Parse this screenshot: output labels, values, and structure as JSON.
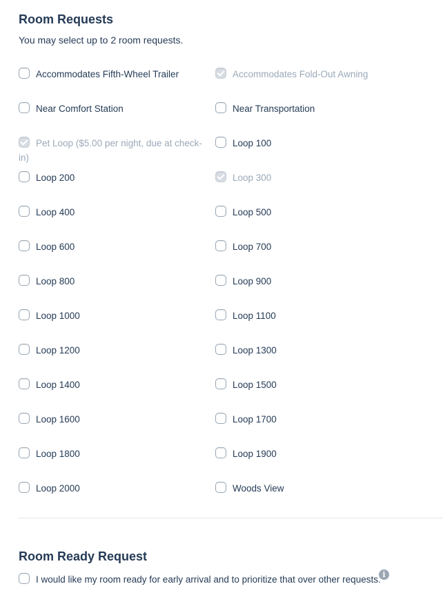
{
  "room_requests": {
    "title": "Room Requests",
    "subtitle": "You may select up to 2 room requests.",
    "options": [
      {
        "label": "Accommodates Fifth-Wheel Trailer",
        "checked": false,
        "disabled": false
      },
      {
        "label": "Accommodates Fold-Out Awning",
        "checked": true,
        "disabled": true
      },
      {
        "label": "Near Comfort Station",
        "checked": false,
        "disabled": false
      },
      {
        "label": "Near Transportation",
        "checked": false,
        "disabled": false
      },
      {
        "label": "Pet Loop ($5.00 per night, due at check-in)",
        "checked": true,
        "disabled": true
      },
      {
        "label": "Loop 100",
        "checked": false,
        "disabled": false
      },
      {
        "label": "Loop 200",
        "checked": false,
        "disabled": false
      },
      {
        "label": "Loop 300",
        "checked": true,
        "disabled": true
      },
      {
        "label": "Loop 400",
        "checked": false,
        "disabled": false
      },
      {
        "label": "Loop 500",
        "checked": false,
        "disabled": false
      },
      {
        "label": "Loop 600",
        "checked": false,
        "disabled": false
      },
      {
        "label": "Loop 700",
        "checked": false,
        "disabled": false
      },
      {
        "label": "Loop 800",
        "checked": false,
        "disabled": false
      },
      {
        "label": "Loop 900",
        "checked": false,
        "disabled": false
      },
      {
        "label": "Loop 1000",
        "checked": false,
        "disabled": false
      },
      {
        "label": "Loop 1100",
        "checked": false,
        "disabled": false
      },
      {
        "label": "Loop 1200",
        "checked": false,
        "disabled": false
      },
      {
        "label": "Loop 1300",
        "checked": false,
        "disabled": false
      },
      {
        "label": "Loop 1400",
        "checked": false,
        "disabled": false
      },
      {
        "label": "Loop 1500",
        "checked": false,
        "disabled": false
      },
      {
        "label": "Loop 1600",
        "checked": false,
        "disabled": false
      },
      {
        "label": "Loop 1700",
        "checked": false,
        "disabled": false
      },
      {
        "label": "Loop 1800",
        "checked": false,
        "disabled": false
      },
      {
        "label": "Loop 1900",
        "checked": false,
        "disabled": false
      },
      {
        "label": "Loop 2000",
        "checked": false,
        "disabled": false
      },
      {
        "label": "Woods View",
        "checked": false,
        "disabled": false
      }
    ]
  },
  "room_ready": {
    "title": "Room Ready Request",
    "checkbox_label": "I would like my room ready for early arrival and to prioritize that over other requests.",
    "checked": false,
    "info_icon": "info-circle-icon",
    "info_glyph": "i"
  },
  "colors": {
    "text": "#253b56",
    "disabled_text": "#9aa9b8",
    "checkbox_border": "#98a6b5",
    "disabled_fill": "#d7dde3",
    "divider": "#e3e7eb"
  }
}
